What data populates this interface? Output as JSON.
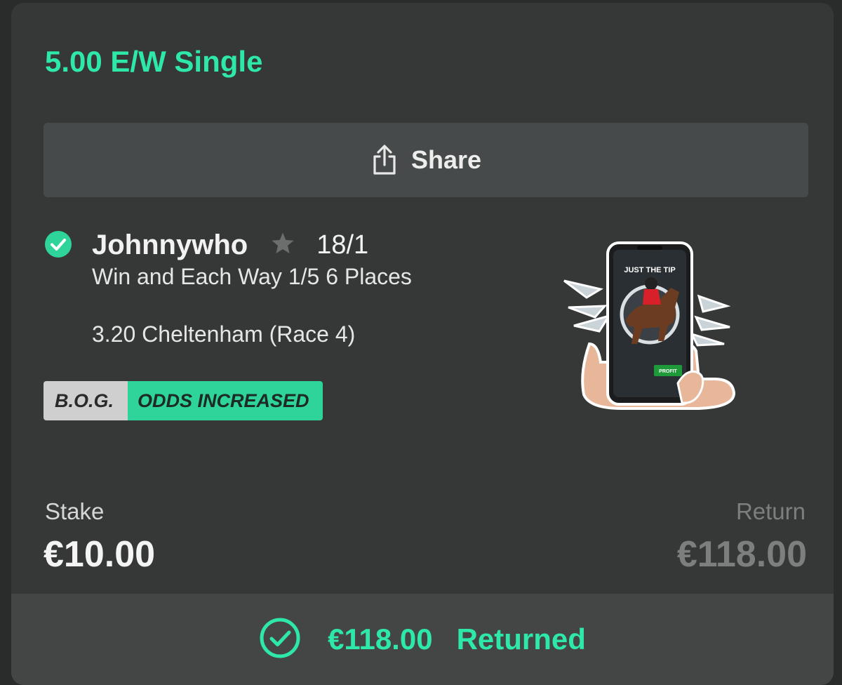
{
  "bet": {
    "title": "5.00 E/W Single",
    "status_icon": "check-circle-icon"
  },
  "share": {
    "label": "Share",
    "icon": "share-icon"
  },
  "selection": {
    "name": "Johnnywho",
    "favourite_icon": "star-icon",
    "odds": "18/1",
    "market": "Win and Each Way 1/5 6 Places",
    "race": "3.20 Cheltenham (Race 4)"
  },
  "badges": {
    "bog": "B.O.G.",
    "odds_increased": "ODDS INCREASED"
  },
  "sticker": {
    "phone_caption": "JUST THE TIP",
    "button_text": "PROFIT"
  },
  "stake": {
    "label": "Stake",
    "value": "€10.00"
  },
  "return": {
    "label": "Return",
    "value": "€118.00"
  },
  "result": {
    "amount": "€118.00",
    "word": "Returned",
    "icon": "check-circle-outline-icon"
  },
  "colors": {
    "accent": "#2ee8a8",
    "background": "#2a2c2c",
    "card": "#363838"
  }
}
